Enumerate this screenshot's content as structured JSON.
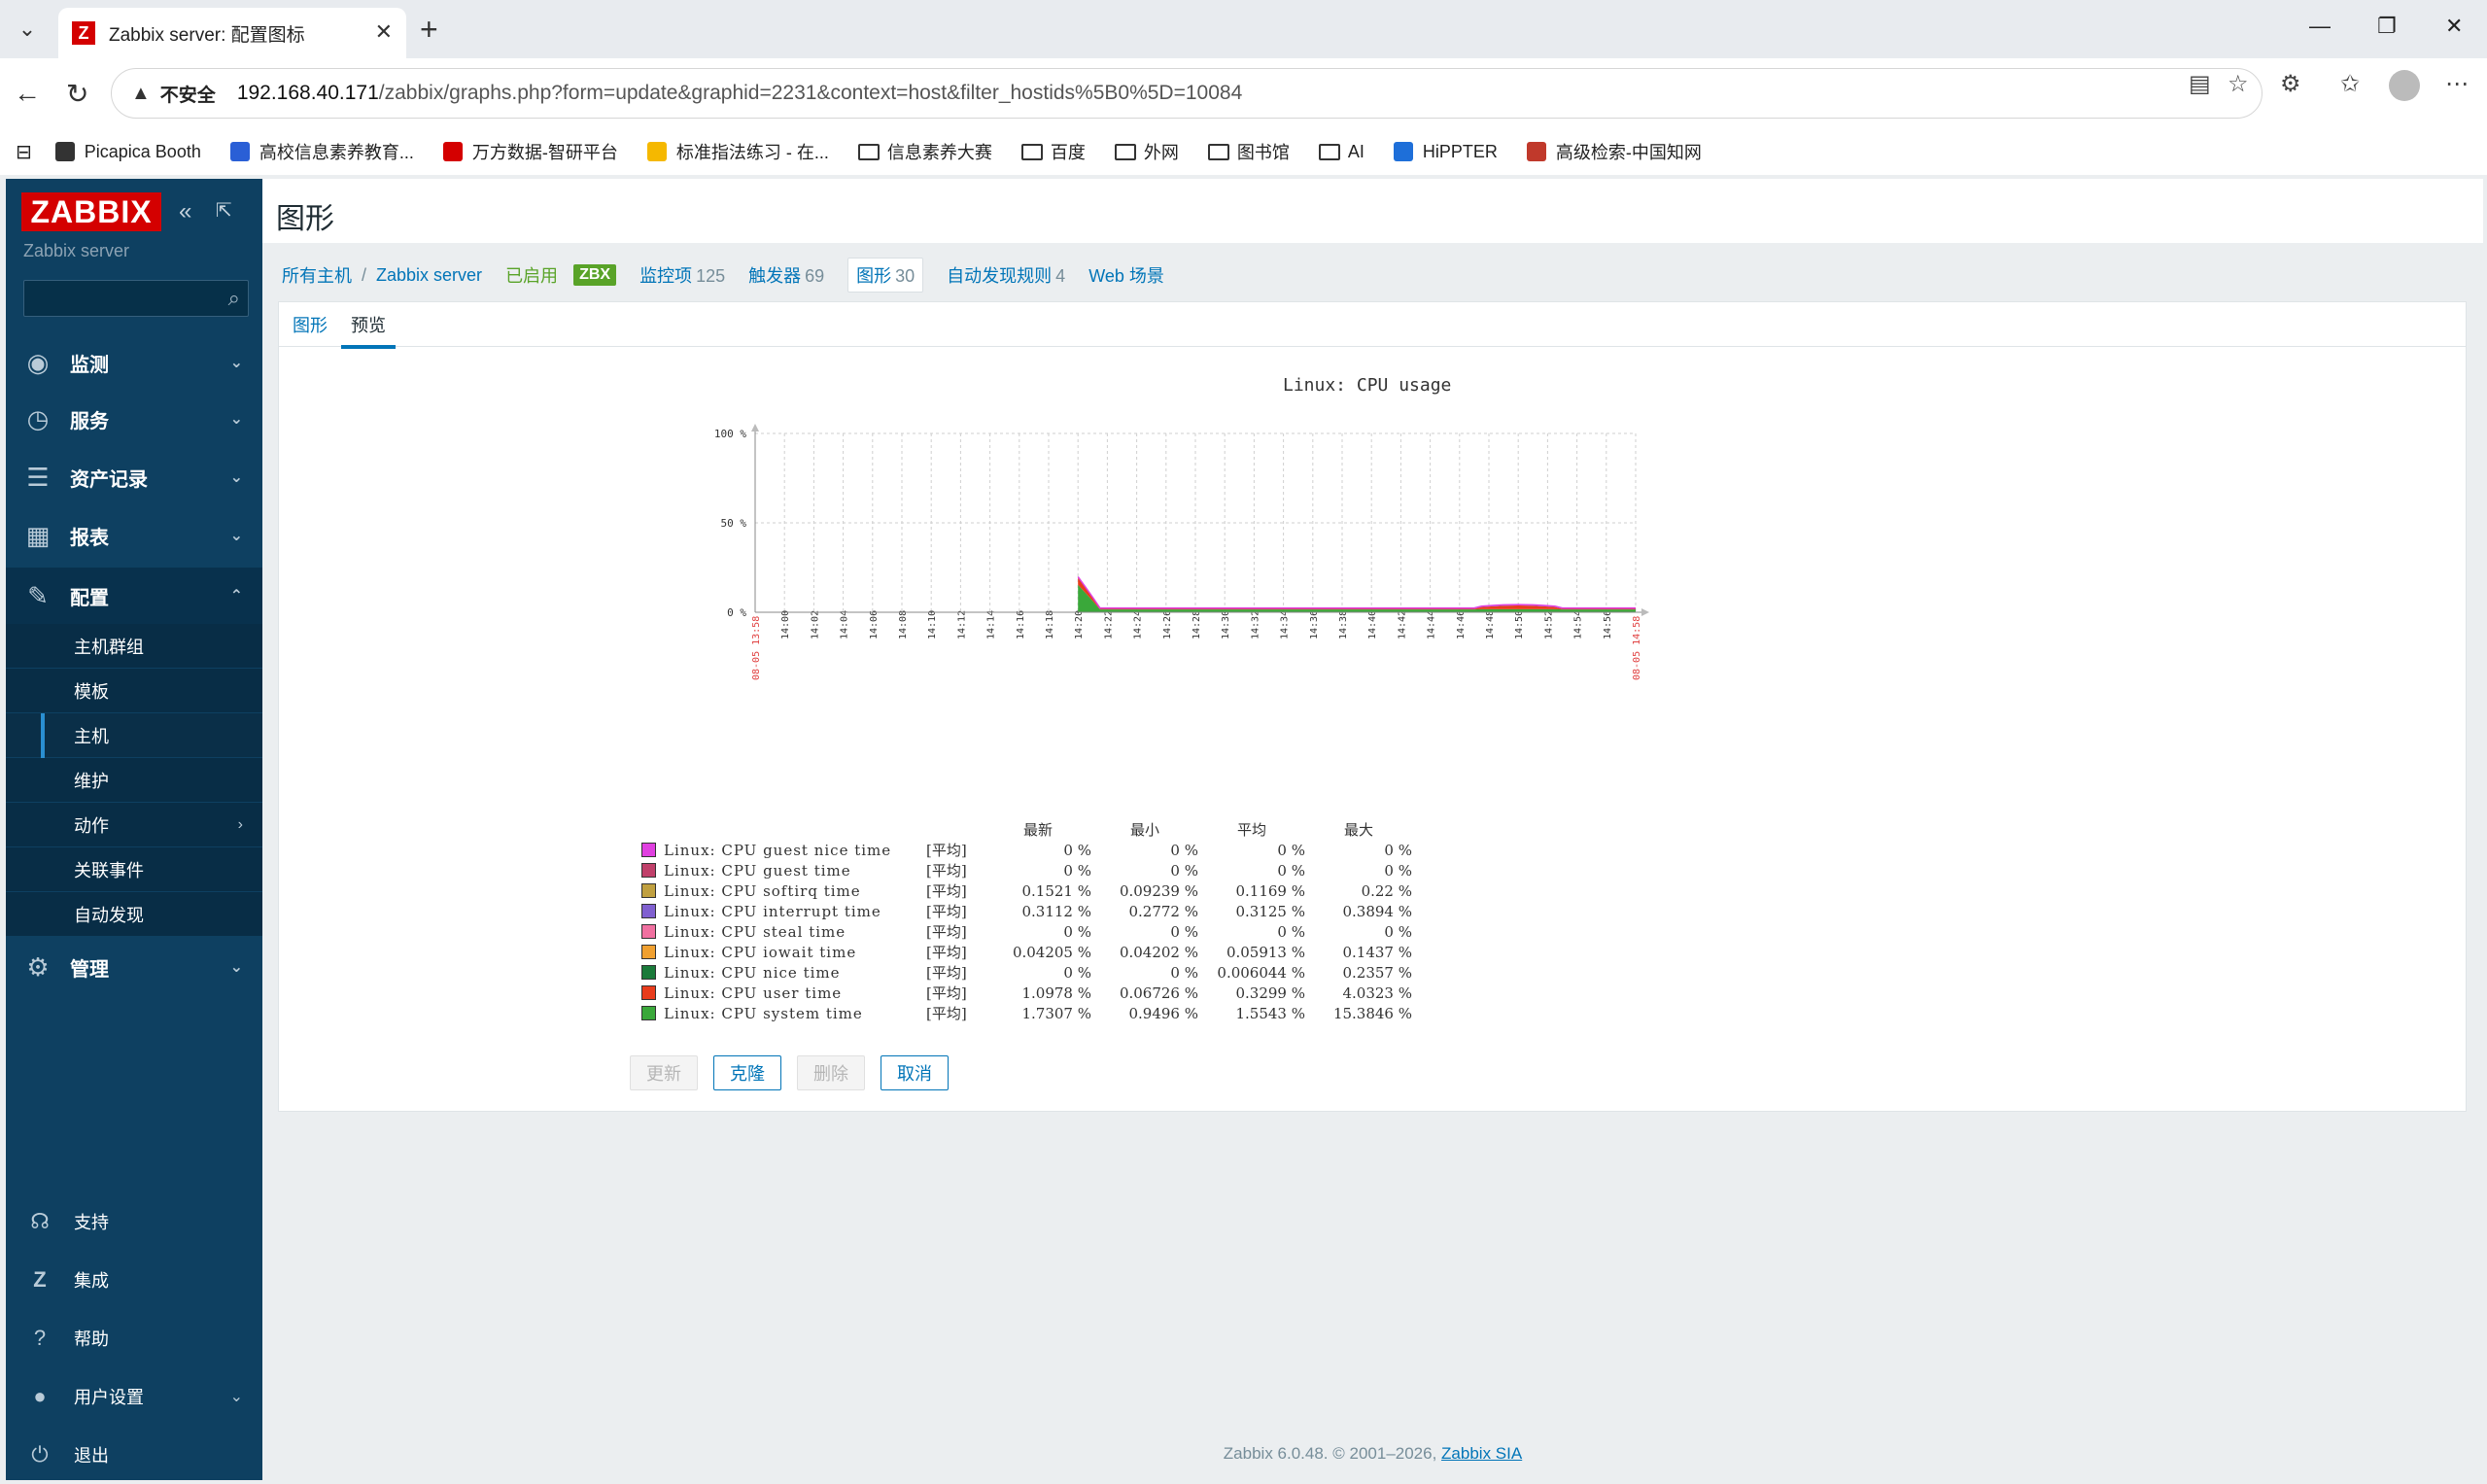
{
  "browser": {
    "tab_title": "Zabbix server: 配置图标",
    "tab_favicon": "Z",
    "insecure_label": "不安全",
    "url_host": "192.168.40.171",
    "url_path": "/zabbix/graphs.php?form=update&graphid=2231&context=host&filter_hostids%5B0%5D=10084",
    "bookmarks": [
      {
        "label": "Picapica Booth",
        "icon": "booth-icon",
        "color": "#333"
      },
      {
        "label": "高校信息素养教育...",
        "icon": "z-icon",
        "color": "#2a5fd6"
      },
      {
        "label": "万方数据-智研平台",
        "icon": "wanfang-icon",
        "color": "#d40000"
      },
      {
        "label": "标准指法练习 - 在...",
        "icon": "duck-icon",
        "color": "#f5b800"
      },
      {
        "label": "信息素养大赛",
        "icon": "folder-icon"
      },
      {
        "label": "百度",
        "icon": "folder-icon"
      },
      {
        "label": "外网",
        "icon": "folder-icon"
      },
      {
        "label": "图书馆",
        "icon": "folder-icon"
      },
      {
        "label": "AI",
        "icon": "folder-icon"
      },
      {
        "label": "HiPPTER",
        "icon": "p-icon",
        "color": "#1e6fd9"
      },
      {
        "label": "高级检索-中国知网",
        "icon": "cnki-icon",
        "color": "#c0392b"
      }
    ]
  },
  "sidebar": {
    "logo": "ZABBIX",
    "server_name": "Zabbix server",
    "menu": [
      {
        "label": "监测",
        "icon": "eye-icon"
      },
      {
        "label": "服务",
        "icon": "clock-icon"
      },
      {
        "label": "资产记录",
        "icon": "list-icon"
      },
      {
        "label": "报表",
        "icon": "bar-chart-icon"
      },
      {
        "label": "配置",
        "icon": "wrench-icon"
      }
    ],
    "submenu": [
      "主机群组",
      "模板",
      "主机",
      "维护",
      "动作",
      "关联事件",
      "自动发现"
    ],
    "admin": {
      "label": "管理",
      "icon": "gear-icon"
    },
    "bottom": [
      {
        "label": "支持",
        "icon": "headset-icon"
      },
      {
        "label": "集成",
        "icon": "z-icon"
      },
      {
        "label": "帮助",
        "icon": "question-icon"
      },
      {
        "label": "用户设置",
        "icon": "user-icon"
      },
      {
        "label": "退出",
        "icon": "power-icon"
      }
    ]
  },
  "page": {
    "title": "图形",
    "hostnav": {
      "all_hosts": "所有主机",
      "host": "Zabbix server",
      "enabled": "已启用",
      "zbx": "ZBX",
      "items": {
        "label": "监控项",
        "count": "125"
      },
      "triggers": {
        "label": "触发器",
        "count": "69"
      },
      "graphs": {
        "label": "图形",
        "count": "30"
      },
      "discovery": {
        "label": "自动发现规则",
        "count": "4"
      },
      "web": "Web 场景"
    },
    "tabs": [
      "图形",
      "预览"
    ],
    "active_tab": "预览",
    "buttons": {
      "update": "更新",
      "clone": "克隆",
      "delete": "删除",
      "cancel": "取消"
    }
  },
  "chart_data": {
    "type": "area",
    "title": "Linux: CPU usage",
    "y_ticks": [
      "100 %",
      "50 %",
      "0 %"
    ],
    "ylim": [
      0,
      100
    ],
    "x_start_label": "08-05 13:58",
    "x_end_label": "08-05 14:58",
    "x_ticks": [
      "14:00",
      "14:02",
      "14:04",
      "14:06",
      "14:08",
      "14:10",
      "14:12",
      "14:14",
      "14:16",
      "14:18",
      "14:20",
      "14:22",
      "14:24",
      "14:26",
      "14:28",
      "14:30",
      "14:32",
      "14:34",
      "14:36",
      "14:38",
      "14:40",
      "14:42",
      "14:44",
      "14:46",
      "14:48",
      "14:50",
      "14:52",
      "14:54",
      "14:56"
    ],
    "legend_headers": [
      "最新",
      "最小",
      "平均",
      "最大"
    ],
    "series": [
      {
        "name": "Linux: CPU guest nice time",
        "fn": "[平均]",
        "color": "#e040e0",
        "last": "0 %",
        "min": "0 %",
        "avg": "0 %",
        "max": "0 %"
      },
      {
        "name": "Linux: CPU guest time",
        "fn": "[平均]",
        "color": "#c0406a",
        "last": "0 %",
        "min": "0 %",
        "avg": "0 %",
        "max": "0 %"
      },
      {
        "name": "Linux: CPU softirq time",
        "fn": "[平均]",
        "color": "#c0a040",
        "last": "0.1521 %",
        "min": "0.09239 %",
        "avg": "0.1169 %",
        "max": "0.22 %"
      },
      {
        "name": "Linux: CPU interrupt time",
        "fn": "[平均]",
        "color": "#8060d0",
        "last": "0.3112 %",
        "min": "0.2772 %",
        "avg": "0.3125 %",
        "max": "0.3894 %"
      },
      {
        "name": "Linux: CPU steal time",
        "fn": "[平均]",
        "color": "#f070a0",
        "last": "0 %",
        "min": "0 %",
        "avg": "0 %",
        "max": "0 %"
      },
      {
        "name": "Linux: CPU iowait time",
        "fn": "[平均]",
        "color": "#f0a030",
        "last": "0.04205 %",
        "min": "0.04202 %",
        "avg": "0.05913 %",
        "max": "0.1437 %"
      },
      {
        "name": "Linux: CPU nice time",
        "fn": "[平均]",
        "color": "#1a7a3a",
        "last": "0 %",
        "min": "0 %",
        "avg": "0.006044 %",
        "max": "0.2357 %"
      },
      {
        "name": "Linux: CPU user time",
        "fn": "[平均]",
        "color": "#e83c1c",
        "last": "1.0978 %",
        "min": "0.06726 %",
        "avg": "0.3299 %",
        "max": "4.0323 %"
      },
      {
        "name": "Linux: CPU system time",
        "fn": "[平均]",
        "color": "#3aa83a",
        "last": "1.7307 %",
        "min": "0.9496 %",
        "avg": "1.5543 %",
        "max": "15.3846 %"
      }
    ]
  },
  "footer": {
    "text": "Zabbix 6.0.48. © 2001–2026, ",
    "link": "Zabbix SIA"
  }
}
